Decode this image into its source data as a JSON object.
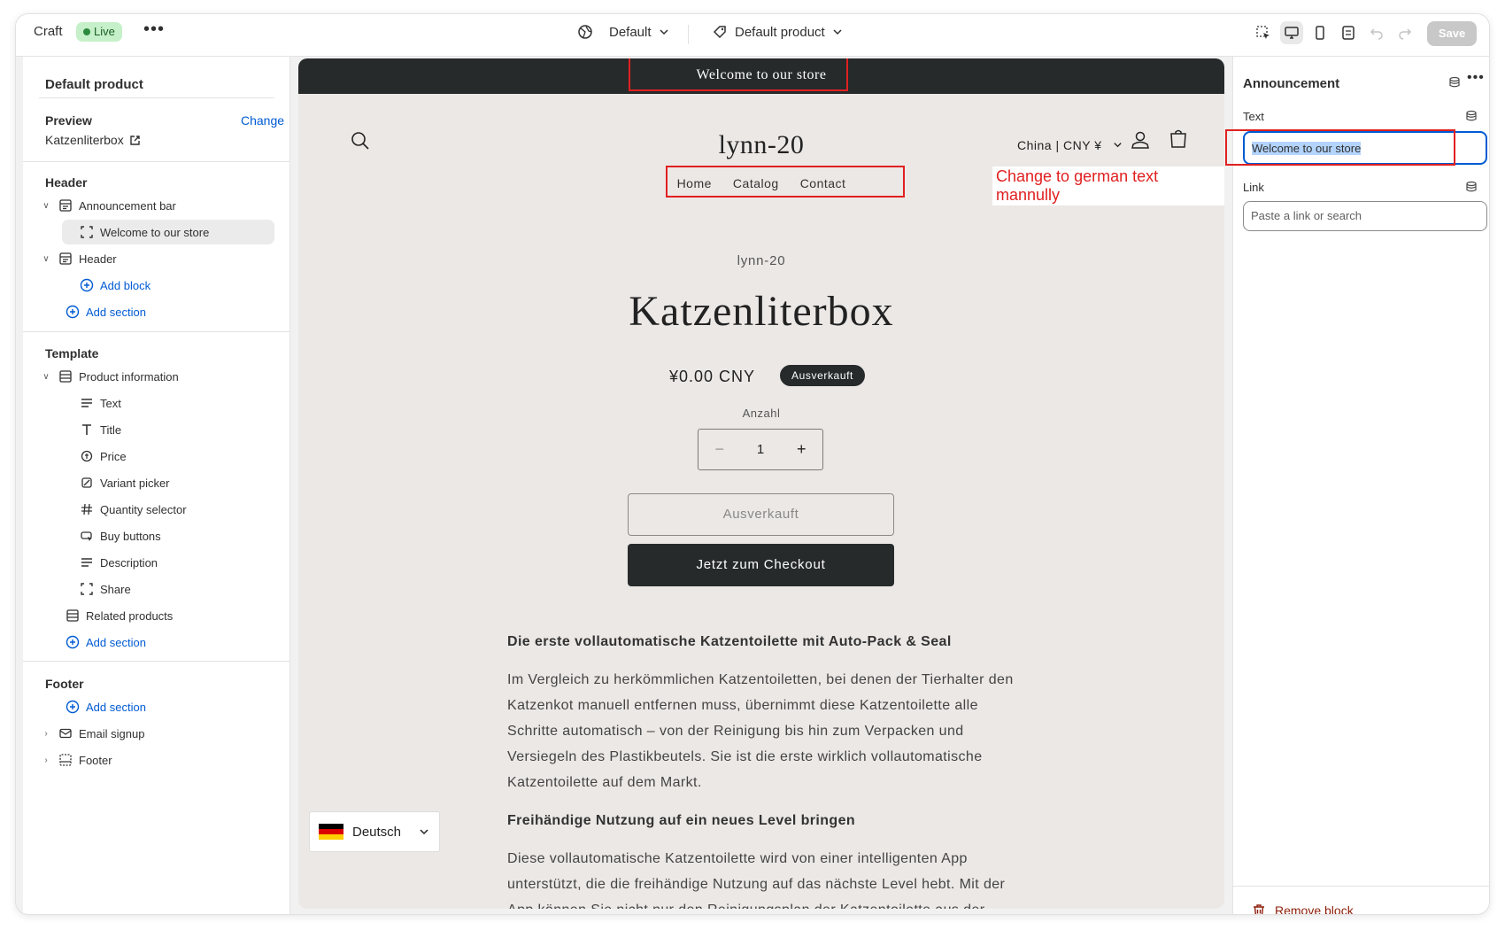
{
  "topbar": {
    "app_name": "Craft",
    "live_badge": "Live",
    "more": "•••",
    "theme_selector": "Default",
    "template_selector": "Default product",
    "save_label": "Save"
  },
  "sidebar": {
    "title": "Default product",
    "preview_label": "Preview",
    "preview_change": "Change",
    "preview_value": "Katzenliterbox",
    "header_section": "Header",
    "header_items": {
      "announcement_bar": "Announcement bar",
      "announcement_block": "Welcome to our store",
      "header": "Header",
      "add_block": "Add block",
      "add_section": "Add section"
    },
    "template_section": "Template",
    "template_items": {
      "product_information": "Product information",
      "text": "Text",
      "title": "Title",
      "price": "Price",
      "variant_picker": "Variant picker",
      "quantity_selector": "Quantity selector",
      "buy_buttons": "Buy buttons",
      "description": "Description",
      "share": "Share",
      "related_products": "Related products",
      "add_section": "Add section"
    },
    "footer_section": "Footer",
    "footer_items": {
      "add_section": "Add section",
      "email_signup": "Email signup",
      "footer": "Footer"
    }
  },
  "preview": {
    "announcement": "Welcome to our store",
    "store_name": "lynn-20",
    "locale_selector": "China | CNY ¥",
    "nav": [
      "Home",
      "Catalog",
      "Contact"
    ],
    "annotation_note": "Change to german text mannully",
    "vendor": "lynn-20",
    "product_title": "Katzenliterbox",
    "price": "¥0.00 CNY",
    "soldout_badge": "Ausverkauft",
    "quantity_label": "Anzahl",
    "quantity_value": "1",
    "soldout_button": "Ausverkauft",
    "checkout_button": "Jetzt zum Checkout",
    "description": {
      "heading1": "Die erste vollautomatische Katzentoilette mit Auto-Pack & Seal",
      "para1": "Im Vergleich zu herkömmlichen Katzentoiletten, bei denen der Tierhalter den Katzenkot manuell entfernen muss, übernimmt diese Katzentoilette alle Schritte automatisch – von der Reinigung bis hin zum Verpacken und Versiegeln des Plastikbeutels. Sie ist die erste wirklich vollautomatische Katzentoilette auf dem Markt.",
      "heading2": "Freihändige Nutzung auf ein neues Level bringen",
      "para2": "Diese vollautomatische Katzentoilette wird von einer intelligenten App unterstützt, die die freihändige Nutzung auf das nächste Level hebt. Mit der App können Sie nicht nur den Reinigungsplan der Katzentoilette aus der"
    },
    "language_selector": "Deutsch"
  },
  "panel": {
    "title": "Announcement",
    "text_label": "Text",
    "text_value": "Welcome to our store",
    "link_label": "Link",
    "link_placeholder": "Paste a link or search",
    "remove_block": "Remove block"
  },
  "colors": {
    "accent": "#005bd3",
    "annotation_red": "#e02020",
    "live_green": "#c6f0c9",
    "dark_bar": "#262a2b",
    "remove_red": "#8e1f0b"
  }
}
